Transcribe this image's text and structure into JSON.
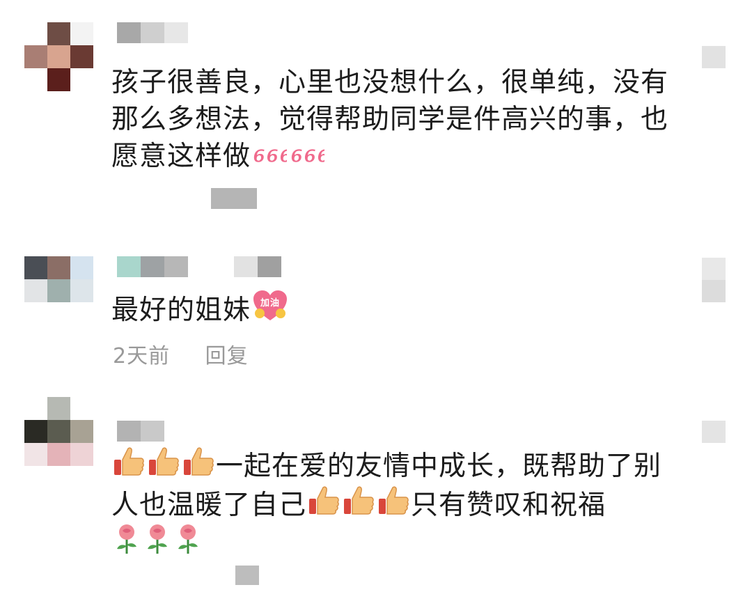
{
  "comments": [
    {
      "text": "孩子很善良，心里也没想什么，很单纯，没有那么多想法，觉得帮助同学是件高兴的事，也愿意这样做",
      "emoji": [
        "666-emoji",
        "666-emoji"
      ]
    },
    {
      "text": "最好的姐妹",
      "emoji": [
        "jiayou-emoji"
      ],
      "badge_text": "加油",
      "time": "2天前",
      "reply": "回复"
    },
    {
      "lead_emoji": [
        "thumbs-up-emoji",
        "thumbs-up-emoji",
        "thumbs-up-emoji"
      ],
      "text_a": "一起在爱的友情中成长，既帮助了别人也温暖了自己",
      "mid_emoji": [
        "thumbs-up-emoji",
        "thumbs-up-emoji",
        "thumbs-up-emoji"
      ],
      "text_b": "只有赞叹和祝福",
      "trail_emoji": [
        "rose-emoji",
        "rose-emoji",
        "rose-emoji"
      ]
    }
  ],
  "colors": {
    "text": "#1c1c1c",
    "meta": "#999999",
    "emoji_pink": "#f06a8c",
    "thumb": "#f6c27a",
    "rose": "#f08a96"
  }
}
